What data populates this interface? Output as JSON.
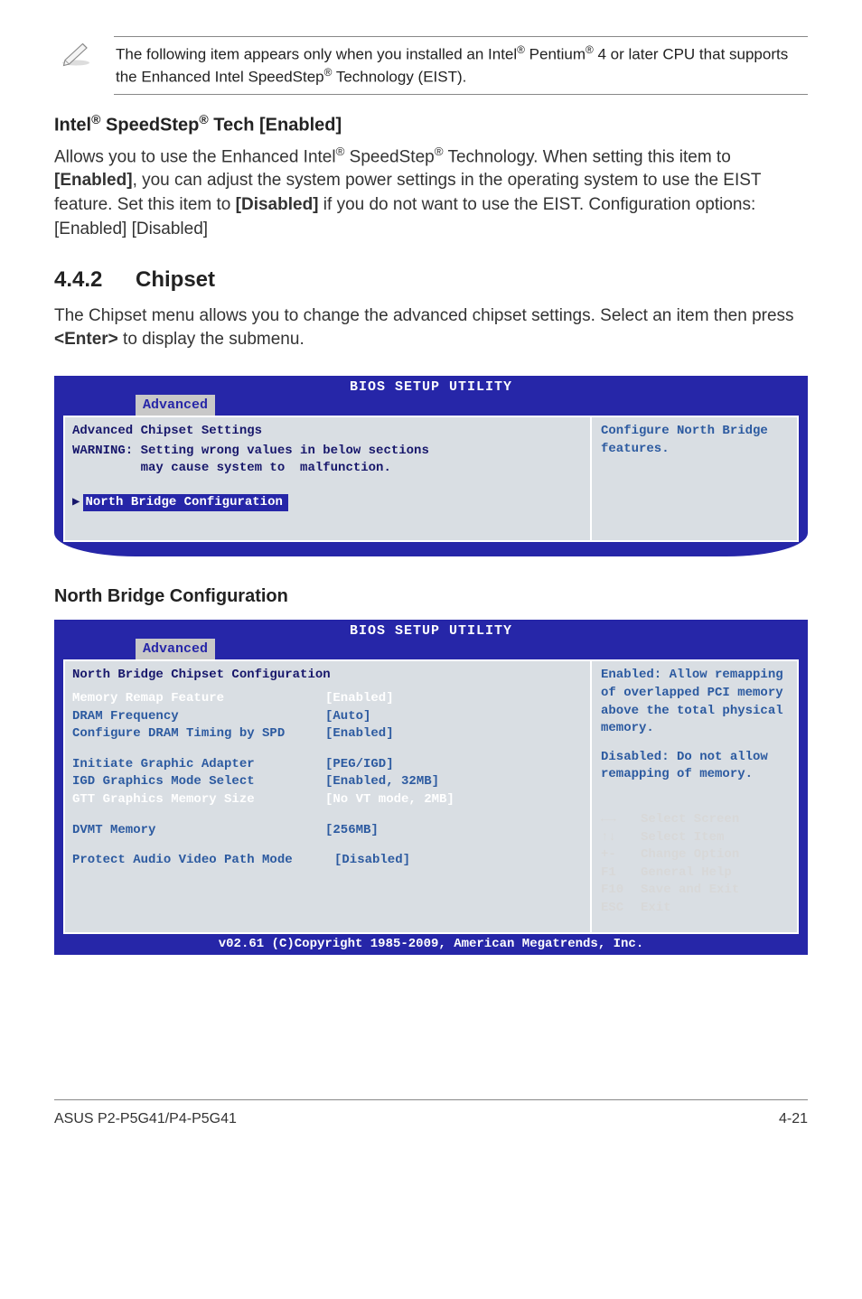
{
  "note": {
    "text_before_reg1": "The following item appears only when you installed an Intel",
    "reg1": "®",
    "text_mid1": " Pentium",
    "reg2": "®",
    "text_mid2": " 4 or later CPU that supports the Enhanced Intel SpeedStep",
    "reg3": "®",
    "text_after": " Technology (EIST)."
  },
  "speedstep": {
    "heading_pre": "Intel",
    "heading_r1": "®",
    "heading_mid": " SpeedStep",
    "heading_r2": "®",
    "heading_post": " Tech [Enabled]",
    "p1a": "Allows you to use the Enhanced Intel",
    "p1r1": "®",
    "p1b": " SpeedStep",
    "p1r2": "®",
    "p1c": " Technology. When setting this item to ",
    "p1_bold1": "[Enabled]",
    "p1d": ", you can adjust the system power settings in the operating system to use the EIST feature. Set this item to ",
    "p1_bold2": "[Disabled]",
    "p1e": " if you do not want to use the EIST. Configuration options: [Enabled] [Disabled]"
  },
  "section": {
    "num": "4.4.2",
    "title": "Chipset",
    "intro_a": "The Chipset menu allows you to change the advanced chipset settings. Select an item then press ",
    "intro_bold": "<Enter>",
    "intro_b": " to display the submenu."
  },
  "bios1": {
    "title": "BIOS SETUP UTILITY",
    "tab": "Advanced",
    "left_heading": "Advanced Chipset Settings",
    "warn_l1": "WARNING: Setting wrong values in below sections",
    "warn_l2": "         may cause system to  malfunction.",
    "item": "North Bridge Configuration",
    "right": "Configure North Bridge features."
  },
  "nbc_heading": "North Bridge Configuration",
  "bios2": {
    "title": "BIOS SETUP UTILITY",
    "tab": "Advanced",
    "left_heading": "North Bridge Chipset Configuration",
    "rows": [
      {
        "k": "Memory Remap Feature",
        "v": "[Enabled]",
        "white": true
      },
      {
        "k": "DRAM Frequency",
        "v": "[Auto]",
        "white": false
      },
      {
        "k": "Configure DRAM Timing by SPD",
        "v": "[Enabled]",
        "white": false
      }
    ],
    "rows2": [
      {
        "k": "Initiate Graphic Adapter",
        "v": "[PEG/IGD]",
        "white": false
      },
      {
        "k": "IGD Graphics Mode Select",
        "v": "[Enabled, 32MB]",
        "white": false
      },
      {
        "k": "GTT Graphics Memory Size",
        "v": "[No VT mode, 2MB]",
        "white": true
      }
    ],
    "rows3": [
      {
        "k": "DVMT Memory",
        "v": "[256MB]",
        "white": false
      }
    ],
    "rows4": [
      {
        "k": "Protect Audio Video Path Mode",
        "v": "[Disabled]",
        "white": false
      }
    ],
    "right_top": "Enabled: Allow remapping of overlapped PCI memory above the total physical memory.",
    "right_mid": "Disabled: Do not allow remapping of memory.",
    "help": [
      {
        "key": "←→",
        "txt": "Select Screen"
      },
      {
        "key": "↑↓",
        "txt": "Select Item"
      },
      {
        "key": "+-",
        "txt": "Change Option"
      },
      {
        "key": "F1",
        "txt": "General Help"
      },
      {
        "key": "F10",
        "txt": "Save and Exit"
      },
      {
        "key": "ESC",
        "txt": "Exit"
      }
    ],
    "footer": "v02.61 (C)Copyright 1985-2009, American Megatrends, Inc."
  },
  "footer": {
    "left": "ASUS P2-P5G41/P4-P5G41",
    "right": "4-21"
  }
}
